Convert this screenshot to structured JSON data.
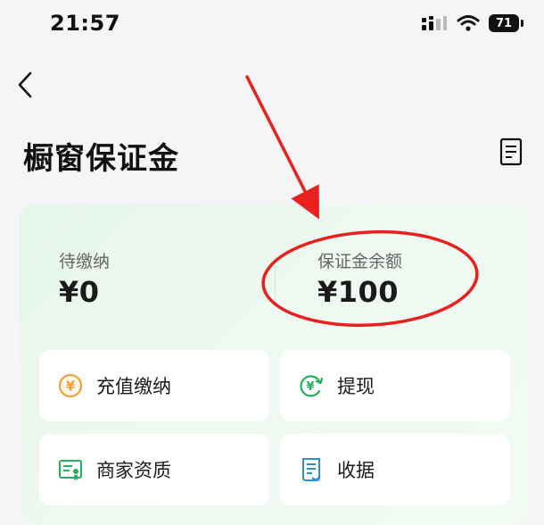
{
  "status_bar": {
    "time": "21:57",
    "battery": "71"
  },
  "header": {
    "title": "橱窗保证金"
  },
  "summary": {
    "pending_label": "待缴纳",
    "pending_value": "¥0",
    "balance_label": "保证金余额",
    "balance_value": "¥100"
  },
  "actions": [
    {
      "label": "充值缴纳",
      "icon": "yen-circle-icon"
    },
    {
      "label": "提现",
      "icon": "yen-refresh-icon"
    },
    {
      "label": "商家资质",
      "icon": "certificate-icon"
    },
    {
      "label": "收据",
      "icon": "receipt-icon"
    }
  ],
  "colors": {
    "accent_green": "#21b15b",
    "accent_orange": "#f0a03c",
    "annotation_red": "#e8201f"
  }
}
